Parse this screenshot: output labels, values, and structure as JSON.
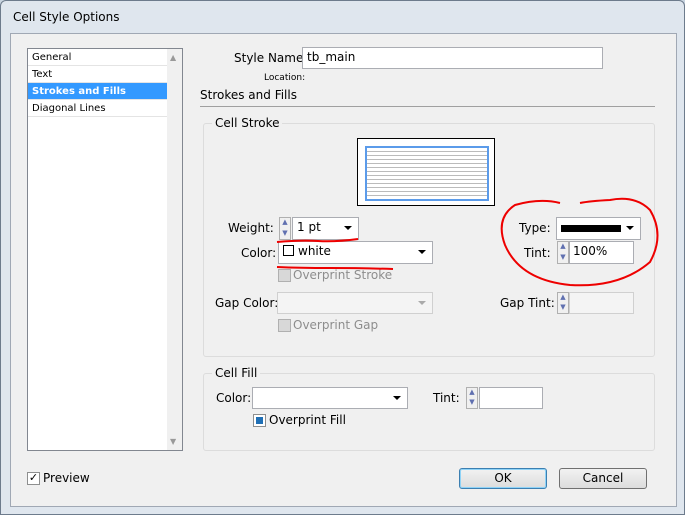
{
  "window": {
    "title": "Cell Style Options"
  },
  "sidebar": {
    "items": [
      {
        "label": "General"
      },
      {
        "label": "Text"
      },
      {
        "label": "Strokes and Fills",
        "selected": true
      },
      {
        "label": "Diagonal Lines"
      }
    ]
  },
  "style_name": {
    "label": "Style Name:",
    "value": "tb_main"
  },
  "location": {
    "label": "Location:"
  },
  "section_title": "Strokes and Fills",
  "cell_stroke": {
    "title": "Cell Stroke",
    "weight_label": "Weight:",
    "weight_value": "1 pt",
    "color_label": "Color:",
    "color_value": "white",
    "overprint_stroke": "Overprint Stroke",
    "gap_color_label": "Gap Color:",
    "gap_color_value": "",
    "overprint_gap": "Overprint Gap",
    "type_label": "Type:",
    "tint_label": "Tint:",
    "tint_value": "100%",
    "gap_tint_label": "Gap Tint:",
    "gap_tint_value": ""
  },
  "cell_fill": {
    "title": "Cell Fill",
    "color_label": "Color:",
    "color_value": "",
    "tint_label": "Tint:",
    "tint_value": "",
    "overprint_fill": "Overprint Fill",
    "overprint_fill_checked": true
  },
  "footer": {
    "preview": "Preview",
    "preview_checked": true,
    "ok": "OK",
    "cancel": "Cancel"
  },
  "colors": {
    "selection": "#3399ff",
    "annotation": "#ff0000"
  }
}
